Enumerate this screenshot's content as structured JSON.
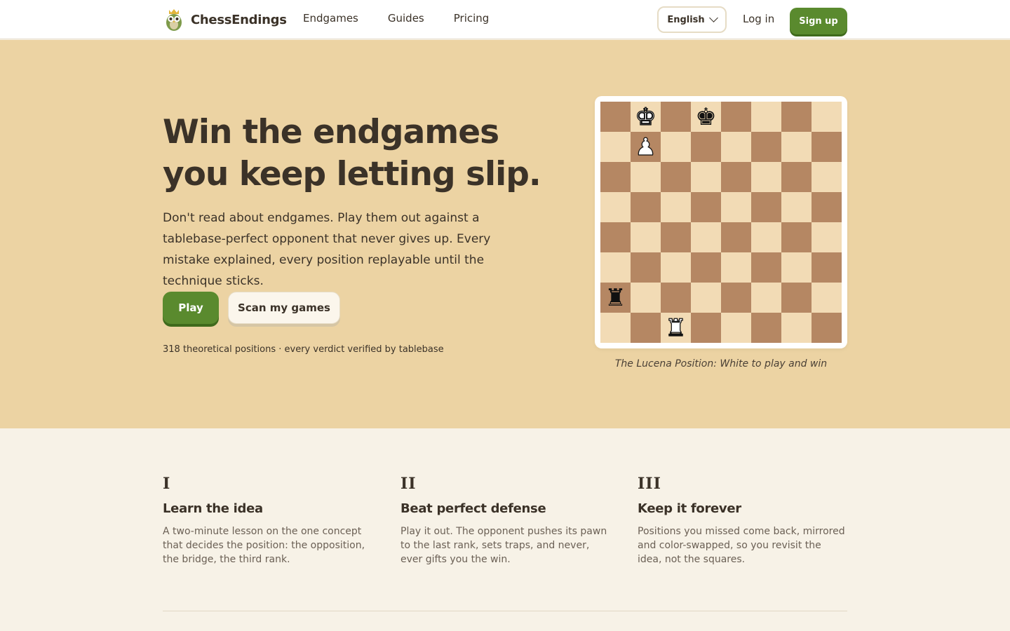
{
  "header": {
    "brand": "ChessEndings",
    "nav": [
      "Endgames",
      "Guides",
      "Pricing"
    ],
    "language": "English",
    "login": "Log in",
    "signup": "Sign up"
  },
  "hero": {
    "title_line1": "Win the endgames",
    "title_line2": "you keep letting slip.",
    "description": "Don't read about endgames. Play them out against a tablebase-perfect opponent that never gives up. Every mistake explained, every position replayable until the technique sticks.",
    "play_button": "Play",
    "scan_button": "Scan my games",
    "stat": "318 theoretical positions · every verdict verified by tablebase",
    "board_caption": "The Lucena Position: White to play and win"
  },
  "board": {
    "pieces": [
      {
        "square": "b8",
        "piece": "K",
        "color": "white"
      },
      {
        "square": "d8",
        "piece": "K",
        "color": "black"
      },
      {
        "square": "b7",
        "piece": "P",
        "color": "white"
      },
      {
        "square": "a2",
        "piece": "R",
        "color": "black"
      },
      {
        "square": "c1",
        "piece": "R",
        "color": "white"
      }
    ],
    "light_color": "#f2dbb5",
    "dark_color": "#b58763"
  },
  "features": [
    {
      "numeral": "I",
      "title": "Learn the idea",
      "text": "A two-minute lesson on the one concept that decides the position: the opposition, the bridge, the third rank."
    },
    {
      "numeral": "II",
      "title": "Beat perfect defense",
      "text": "Play it out. The opponent pushes its pawn to the last rank, sets traps, and never, ever gifts you the win."
    },
    {
      "numeral": "III",
      "title": "Keep it forever",
      "text": "Positions you missed come back, mirrored and color-swapped, so you revisit the idea, not the squares."
    }
  ],
  "colors": {
    "accent_green": "#5a8a2e",
    "hero_bg": "#ecd3a3",
    "page_bg": "#f7f2e7",
    "text": "#3b3228"
  }
}
